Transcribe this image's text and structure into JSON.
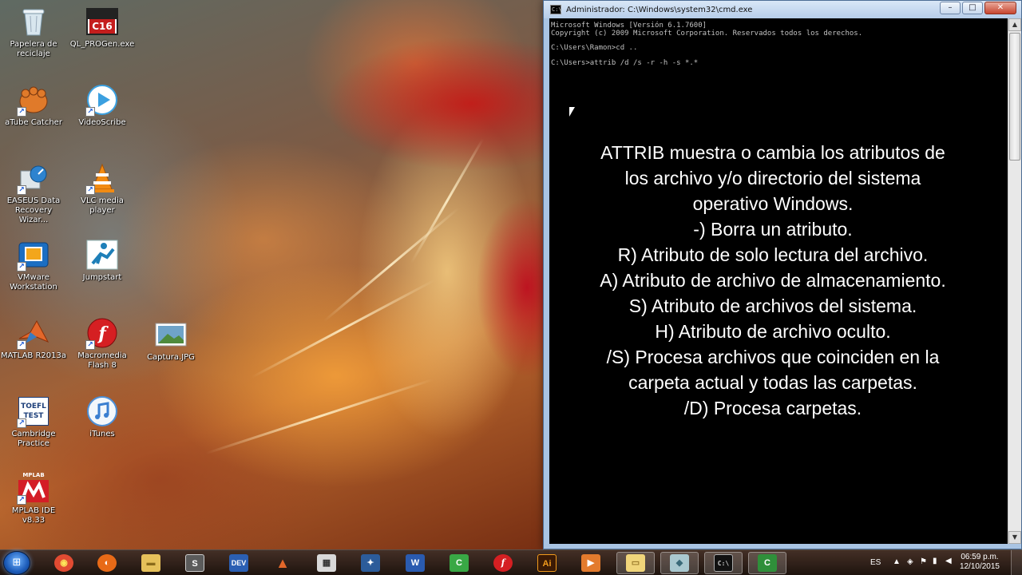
{
  "desktop": {
    "icons": [
      {
        "label": "Papelera de reciclaje",
        "icon": "recycle-bin-icon"
      },
      {
        "label": "QL_PROGen.exe",
        "icon": "c16-app-icon",
        "badge": "C16"
      },
      {
        "label": "aTube Catcher",
        "icon": "atube-catcher-icon"
      },
      {
        "label": "VideoScribe",
        "icon": "videoscribe-icon"
      },
      {
        "label": "EASEUS Data Recovery Wizar...",
        "icon": "easeus-icon"
      },
      {
        "label": "VLC media player",
        "icon": "vlc-cone-icon"
      },
      {
        "label": "VMware Workstation",
        "icon": "vmware-icon"
      },
      {
        "label": "Jumpstart",
        "icon": "jumpstart-icon"
      },
      {
        "label": "MATLAB R2013a",
        "icon": "matlab-icon"
      },
      {
        "label": "Macromedia Flash 8",
        "icon": "flash-icon"
      },
      {
        "label": "Captura.JPG",
        "icon": "image-file-icon"
      },
      {
        "label": "Cambridge Practice",
        "icon": "toefl-icon",
        "badge": "TOEFL TEST"
      },
      {
        "label": "iTunes",
        "icon": "itunes-icon"
      },
      {
        "label": "MPLAB IDE v8.33",
        "icon": "mplab-icon",
        "badge": "MPLAB IDE"
      }
    ]
  },
  "cmd": {
    "title": "Administrador: C:\\Windows\\system32\\cmd.exe",
    "lines": [
      "Microsoft Windows [Versión 6.1.7600]",
      "Copyright (c) 2009 Microsoft Corporation. Reservados todos los derechos.",
      "",
      "C:\\Users\\Ramon>cd ..",
      "",
      "C:\\Users>attrib /d /s -r -h -s *.*"
    ],
    "overlay": [
      "ATTRIB muestra o cambia los atributos de",
      "los archivo y/o directorio del sistema",
      "operativo Windows.",
      "-) Borra un atributo.",
      "R) Atributo de solo lectura del archivo.",
      "A) Atributo de archivo de almacenamiento.",
      "S) Atributo de archivos del sistema.",
      "H) Atributo de archivo oculto.",
      "/S) Procesa archivos que coinciden en la",
      "carpeta actual y todas las carpetas.",
      "/D) Procesa carpetas."
    ],
    "buttons": {
      "minimize": "–",
      "maximize": "□",
      "close": "✕"
    }
  },
  "taskbar": {
    "pinned": [
      {
        "name": "chrome",
        "glyph": "◉",
        "color": "#e14b32"
      },
      {
        "name": "firefox",
        "glyph": "◐",
        "color": "#e86a17"
      },
      {
        "name": "explorer",
        "glyph": "▬",
        "color": "#e6c15a"
      },
      {
        "name": "s-app",
        "glyph": "S",
        "color": "#5b5b5b"
      },
      {
        "name": "dev-cpp",
        "glyph": "DEV",
        "color": "#2b5fb3"
      },
      {
        "name": "matlab",
        "glyph": "▲",
        "color": "#d4531d"
      },
      {
        "name": "calculator",
        "glyph": "▦",
        "color": "#d9d9d9"
      },
      {
        "name": "network-tool",
        "glyph": "✦",
        "color": "#2c5c9a"
      },
      {
        "name": "word",
        "glyph": "W",
        "color": "#2a5bb0"
      },
      {
        "name": "camtasia",
        "glyph": "C",
        "color": "#39a845"
      },
      {
        "name": "flash",
        "glyph": "f",
        "color": "#d51f22"
      },
      {
        "name": "illustrator",
        "glyph": "Ai",
        "color": "#3b1a05"
      },
      {
        "name": "media-player",
        "glyph": "▶",
        "color": "#e37b2d"
      },
      {
        "name": "folder",
        "glyph": "▭",
        "color": "#f0d57a"
      },
      {
        "name": "app-box",
        "glyph": "◆",
        "color": "#a9c8cf"
      },
      {
        "name": "cmd",
        "glyph": "C:\\",
        "color": "#111111"
      },
      {
        "name": "camtasia-recorder",
        "glyph": "C",
        "color": "#2f8f3a"
      }
    ],
    "language": "ES",
    "clock_time": "06:59 p.m.",
    "clock_date": "12/10/2015"
  },
  "colors": {
    "cmd_background": "#000000",
    "cmd_text": "#c0c0c0",
    "overlay_text": "#ffffff",
    "titlebar": "#b6cde9"
  }
}
